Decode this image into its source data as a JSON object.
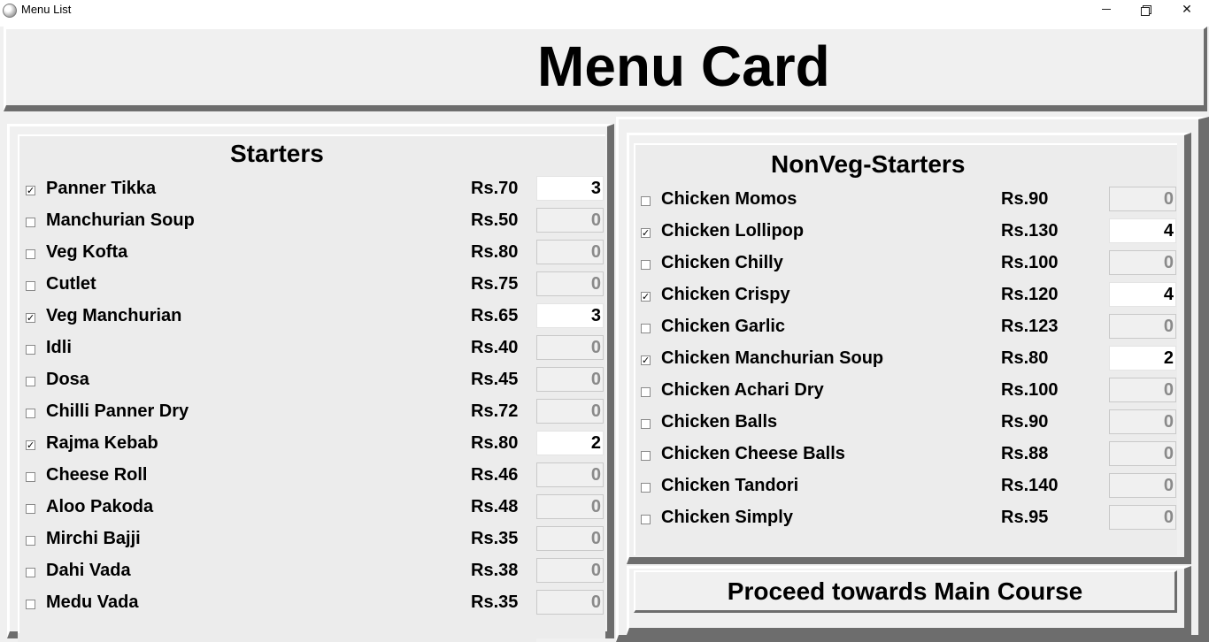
{
  "window": {
    "title": "Menu List",
    "controls": {
      "minimize": "minimize-icon",
      "maximize": "restore-icon",
      "close": "✕"
    }
  },
  "header": {
    "title": "Menu Card"
  },
  "starters": {
    "title": "Starters",
    "items": [
      {
        "name": "Panner Tikka",
        "price": "Rs.70",
        "checked": true,
        "qty": "3"
      },
      {
        "name": "Manchurian Soup",
        "price": "Rs.50",
        "checked": false,
        "qty": "0"
      },
      {
        "name": "Veg Kofta",
        "price": "Rs.80",
        "checked": false,
        "qty": "0"
      },
      {
        "name": "Cutlet",
        "price": "Rs.75",
        "checked": false,
        "qty": "0"
      },
      {
        "name": "Veg Manchurian",
        "price": "Rs.65",
        "checked": true,
        "qty": "3"
      },
      {
        "name": "Idli",
        "price": "Rs.40",
        "checked": false,
        "qty": "0"
      },
      {
        "name": "Dosa",
        "price": "Rs.45",
        "checked": false,
        "qty": "0"
      },
      {
        "name": "Chilli Panner Dry",
        "price": "Rs.72",
        "checked": false,
        "qty": "0"
      },
      {
        "name": "Rajma Kebab",
        "price": "Rs.80",
        "checked": true,
        "qty": "2"
      },
      {
        "name": "Cheese Roll",
        "price": "Rs.46",
        "checked": false,
        "qty": "0"
      },
      {
        "name": "Aloo Pakoda",
        "price": "Rs.48",
        "checked": false,
        "qty": "0"
      },
      {
        "name": "Mirchi Bajji",
        "price": "Rs.35",
        "checked": false,
        "qty": "0"
      },
      {
        "name": "Dahi Vada",
        "price": "Rs.38",
        "checked": false,
        "qty": "0"
      },
      {
        "name": "Medu Vada",
        "price": "Rs.35",
        "checked": false,
        "qty": "0"
      }
    ]
  },
  "nonveg": {
    "title": "NonVeg-Starters",
    "items": [
      {
        "name": "Chicken Momos",
        "price": "Rs.90",
        "checked": false,
        "qty": "0"
      },
      {
        "name": "Chicken Lollipop",
        "price": "Rs.130",
        "checked": true,
        "qty": "4"
      },
      {
        "name": "Chicken Chilly",
        "price": "Rs.100",
        "checked": false,
        "qty": "0"
      },
      {
        "name": "Chicken Crispy",
        "price": "Rs.120",
        "checked": true,
        "qty": "4"
      },
      {
        "name": "Chicken Garlic",
        "price": "Rs.123",
        "checked": false,
        "qty": "0"
      },
      {
        "name": "Chicken Manchurian Soup",
        "price": "Rs.80",
        "checked": true,
        "qty": "2"
      },
      {
        "name": "Chicken Achari Dry",
        "price": "Rs.100",
        "checked": false,
        "qty": "0"
      },
      {
        "name": "Chicken Balls",
        "price": "Rs.90",
        "checked": false,
        "qty": "0"
      },
      {
        "name": "Chicken Cheese Balls",
        "price": "Rs.88",
        "checked": false,
        "qty": "0"
      },
      {
        "name": "Chicken Tandori",
        "price": "Rs.140",
        "checked": false,
        "qty": "0"
      },
      {
        "name": "Chicken Simply",
        "price": "Rs.95",
        "checked": false,
        "qty": "0"
      }
    ]
  },
  "proceed_button": {
    "label": "Proceed towards Main Course"
  },
  "colors": {
    "window_bg": "#f0f0f0",
    "bevel_dark": "#6d6d6d",
    "disabled_text": "#8a8a8a"
  }
}
